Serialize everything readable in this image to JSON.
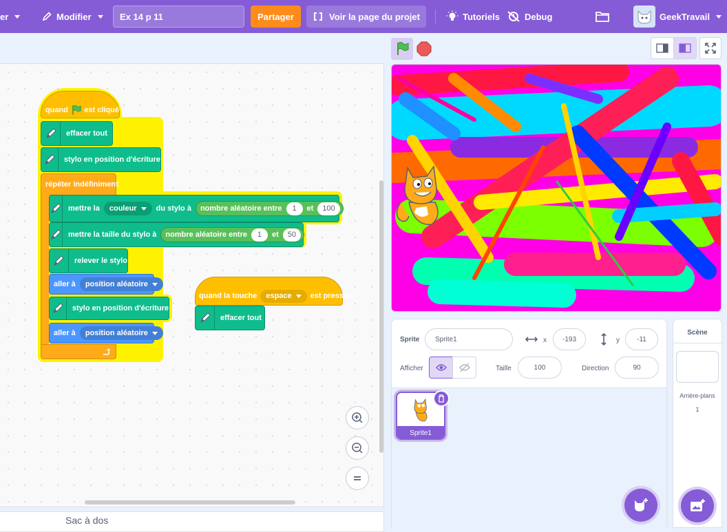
{
  "menu": {
    "file_label": "er",
    "edit_label": "Modifier",
    "project_title": "Ex 14 p 11",
    "share_label": "Partager",
    "see_project_label": "Voir la page du projet",
    "tutorials_label": "Tutoriels",
    "debug_label": "Debug",
    "username": "GeekTravail"
  },
  "scripts": {
    "main": {
      "hat_when": "quand",
      "hat_clicked": "est cliqué",
      "clear_all": "effacer tout",
      "pen_down": "stylo en position d'écriture",
      "forever": "répéter indéfiniment",
      "set_pen": "mettre la",
      "pen_param": "couleur",
      "of_pen_to": "du stylo à",
      "random_between": "nombre aléatoire entre",
      "and": "et",
      "color_min": "1",
      "color_max": "100",
      "set_size": "mettre la taille du stylo à",
      "size_min": "1",
      "size_max": "50",
      "pen_up": "relever le stylo",
      "go_to": "aller à",
      "random_position": "position aléatoire",
      "pen_down_2": "stylo en position d'écriture",
      "go_to_2": "aller à",
      "random_position_2": "position aléatoire"
    },
    "key": {
      "when_key": "quand la touche",
      "key_name": "espace",
      "pressed": "est pressée",
      "clear_all": "effacer tout"
    }
  },
  "backpack_label": "Sac à dos",
  "sprite_info": {
    "sprite_label": "Sprite",
    "sprite_name": "Sprite1",
    "x_label": "x",
    "x_value": "-193",
    "y_label": "y",
    "y_value": "-11",
    "show_label": "Afficher",
    "size_label": "Taille",
    "size_value": "100",
    "direction_label": "Direction",
    "direction_value": "90"
  },
  "sprites": [
    {
      "name": "Sprite1",
      "selected": true
    }
  ],
  "stage_panel": {
    "title": "Scène",
    "backdrops_label": "Arrière-plans",
    "backdrops_count": "1"
  },
  "colors": {
    "menu_bar": "#855cd6",
    "events": "#ffbf00",
    "control": "#ffab19",
    "pen": "#0fbd8c",
    "motion": "#4c97ff",
    "operators": "#59c059",
    "share": "#ff8c1a",
    "glow": "#fff200"
  }
}
